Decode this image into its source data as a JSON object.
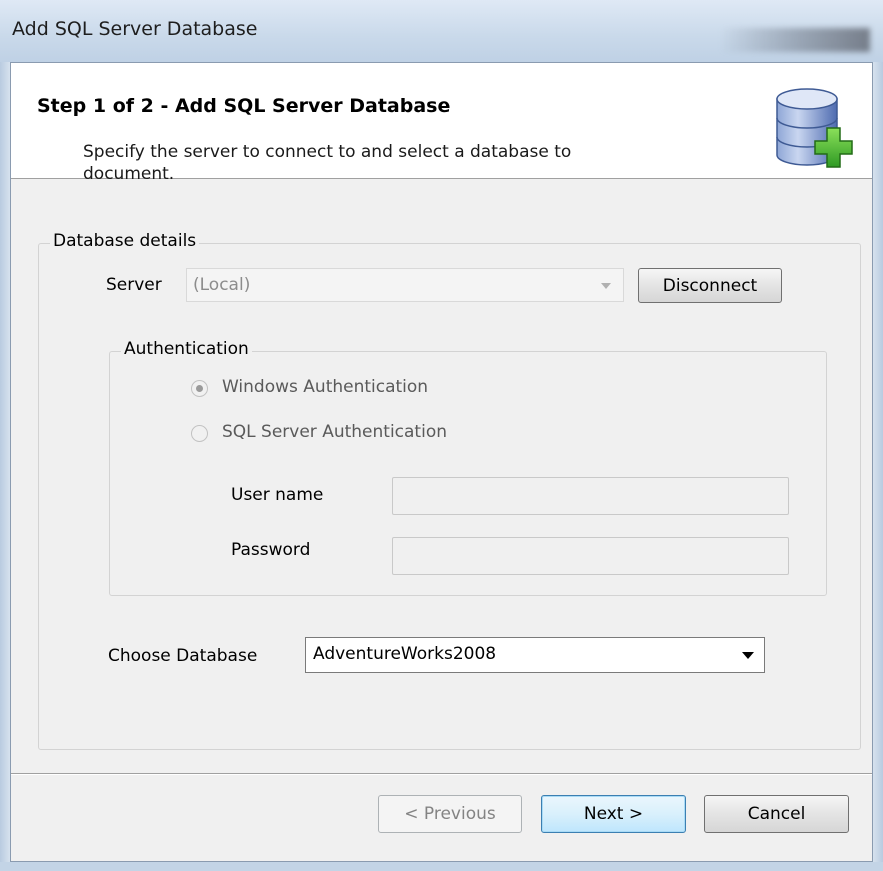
{
  "window": {
    "title": "Add SQL Server Database"
  },
  "header": {
    "step_title": "Step 1 of 2 - Add SQL Server Database",
    "description": "Specify the server to connect to and select a database to document.",
    "icon": "database-add-icon"
  },
  "database_details": {
    "legend": "Database details",
    "server_label": "Server",
    "server_value": "(Local)",
    "disconnect_label": "Disconnect"
  },
  "authentication": {
    "legend": "Authentication",
    "options": [
      {
        "label": "Windows Authentication",
        "selected": true
      },
      {
        "label": "SQL Server Authentication",
        "selected": false
      }
    ],
    "username_label": "User name",
    "username_value": "",
    "password_label": "Password",
    "password_value": ""
  },
  "database": {
    "label": "Choose Database",
    "selected": "AdventureWorks2008"
  },
  "footer": {
    "previous_label": "< Previous",
    "next_label": "Next >",
    "cancel_label": "Cancel"
  },
  "colors": {
    "titlebar": "#c9d9ea",
    "client_bg": "#f0f0f0",
    "icon_green": "#3fb33a",
    "icon_blue": "#5a78b8"
  }
}
